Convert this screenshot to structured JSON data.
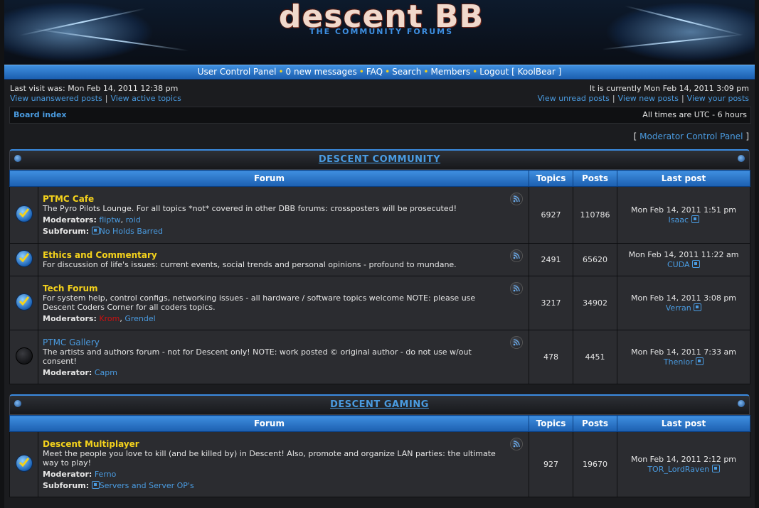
{
  "header": {
    "logo_title": "descent BB",
    "logo_subtitle": "THE COMMUNITY FORUMS"
  },
  "nav": {
    "items": [
      "User Control Panel",
      "0 new messages",
      "FAQ",
      "Search",
      "Members"
    ],
    "logout": "Logout [ KoolBear ]"
  },
  "info": {
    "last_visit": "Last visit was: Mon Feb 14, 2011 12:38 pm",
    "view_unanswered": "View unanswered posts",
    "view_active": "View active topics",
    "current_time": "It is currently Mon Feb 14, 2011 3:09 pm",
    "view_unread": "View unread posts",
    "view_new": "View new posts",
    "view_your": "View your posts"
  },
  "breadcrumb": {
    "board_index": "Board index",
    "timezone": "All times are UTC - 6 hours"
  },
  "moderator_cp": "Moderator Control Panel",
  "columns": {
    "forum": "Forum",
    "topics": "Topics",
    "posts": "Posts",
    "last_post": "Last post"
  },
  "categories": [
    {
      "title": "DESCENT COMMUNITY",
      "forums": [
        {
          "name": "PTMC Cafe",
          "desc": "The Pyro Pilots Lounge. For all topics *not* covered in other DBB forums: crossposters will be prosecuted!",
          "mod_label": "Moderators:",
          "mods": [
            "fliptw",
            "roid"
          ],
          "sub_label": "Subforum:",
          "subforum": "No Holds Barred",
          "topics": "6927",
          "posts": "110786",
          "last_date": "Mon Feb 14, 2011 1:51 pm",
          "last_user": "Isaac"
        },
        {
          "name": "Ethics and Commentary",
          "desc": "For discussion of life's issues: current events, social trends and personal opinions - profound to mundane.",
          "topics": "2491",
          "posts": "65620",
          "last_date": "Mon Feb 14, 2011 11:22 am",
          "last_user": "CUDA"
        },
        {
          "name": "Tech Forum",
          "desc": "For system help, control configs, networking issues - all hardware / software topics welcome NOTE: please use Descent Coders Corner for all coders topics.",
          "mod_label": "Moderators:",
          "mods": [
            "Krom",
            "Grendel"
          ],
          "topics": "3217",
          "posts": "34902",
          "last_date": "Mon Feb 14, 2011 3:08 pm",
          "last_user": "Verran"
        },
        {
          "name": "PTMC Gallery",
          "desc": "The artists and authors forum - not for Descent only! NOTE: work posted © original author - do not use w/out consent!",
          "mod_label": "Moderator:",
          "mods": [
            "Capm"
          ],
          "topics": "478",
          "posts": "4451",
          "last_date": "Mon Feb 14, 2011 7:33 am",
          "last_user": "Thenior"
        }
      ]
    },
    {
      "title": "DESCENT GAMING",
      "forums": [
        {
          "name": "Descent Multiplayer",
          "desc": "Meet the people you love to kill (and be killed by) in Descent! Also, promote and organize LAN parties: the ultimate way to play!",
          "mod_label": "Moderator:",
          "mods": [
            "Ferno"
          ],
          "sub_label": "Subforum:",
          "subforum": "Servers and Server OP's",
          "topics": "927",
          "posts": "19670",
          "last_date": "Mon Feb 14, 2011 2:12 pm",
          "last_user": "TOR_LordRaven"
        }
      ]
    }
  ],
  "colors": {
    "accent": "#3f8fe0",
    "forum_title": "#f4d21c",
    "link": "#4a9be0",
    "moderator_red": "#cc1010"
  },
  "icons": [
    "rss-feed-icon",
    "forum-unread-icon",
    "forum-read-icon",
    "view-latest-post-icon"
  ]
}
